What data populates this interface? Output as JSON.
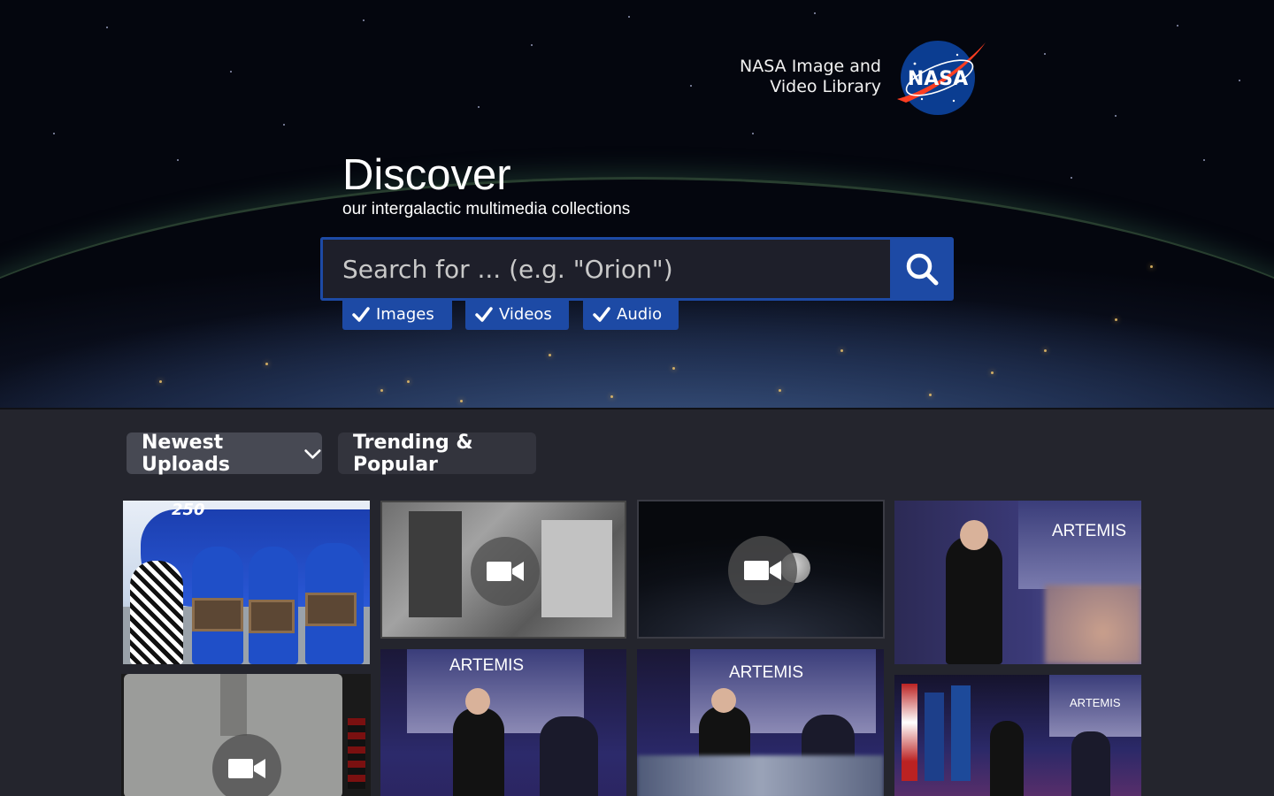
{
  "header": {
    "brand_line1": "NASA Image and",
    "brand_line2": "Video Library",
    "logo_icon": "nasa-meatball-logo"
  },
  "hero": {
    "title": "Discover",
    "tagline": "our intergalactic multimedia collections"
  },
  "search": {
    "placeholder": "Search for ... (e.g. \"Orion\")",
    "value": "",
    "button_icon": "search-icon"
  },
  "filters": [
    {
      "label": "Images",
      "checked": true
    },
    {
      "label": "Videos",
      "checked": true
    },
    {
      "label": "Audio",
      "checked": true
    }
  ],
  "tabs": {
    "newest": "Newest Uploads",
    "trending": "Trending & Popular"
  },
  "tiles": {
    "t4_banner": "ARTEMIS",
    "t6_banner": "ARTEMIS",
    "t7_banner": "ARTEMIS",
    "t8_banner": "ARTEMIS",
    "t1_banner": "250"
  },
  "colors": {
    "accent": "#1d4aa5",
    "page_bg": "#24252d",
    "tab_active": "#474953",
    "tab_inactive": "#33343d"
  }
}
